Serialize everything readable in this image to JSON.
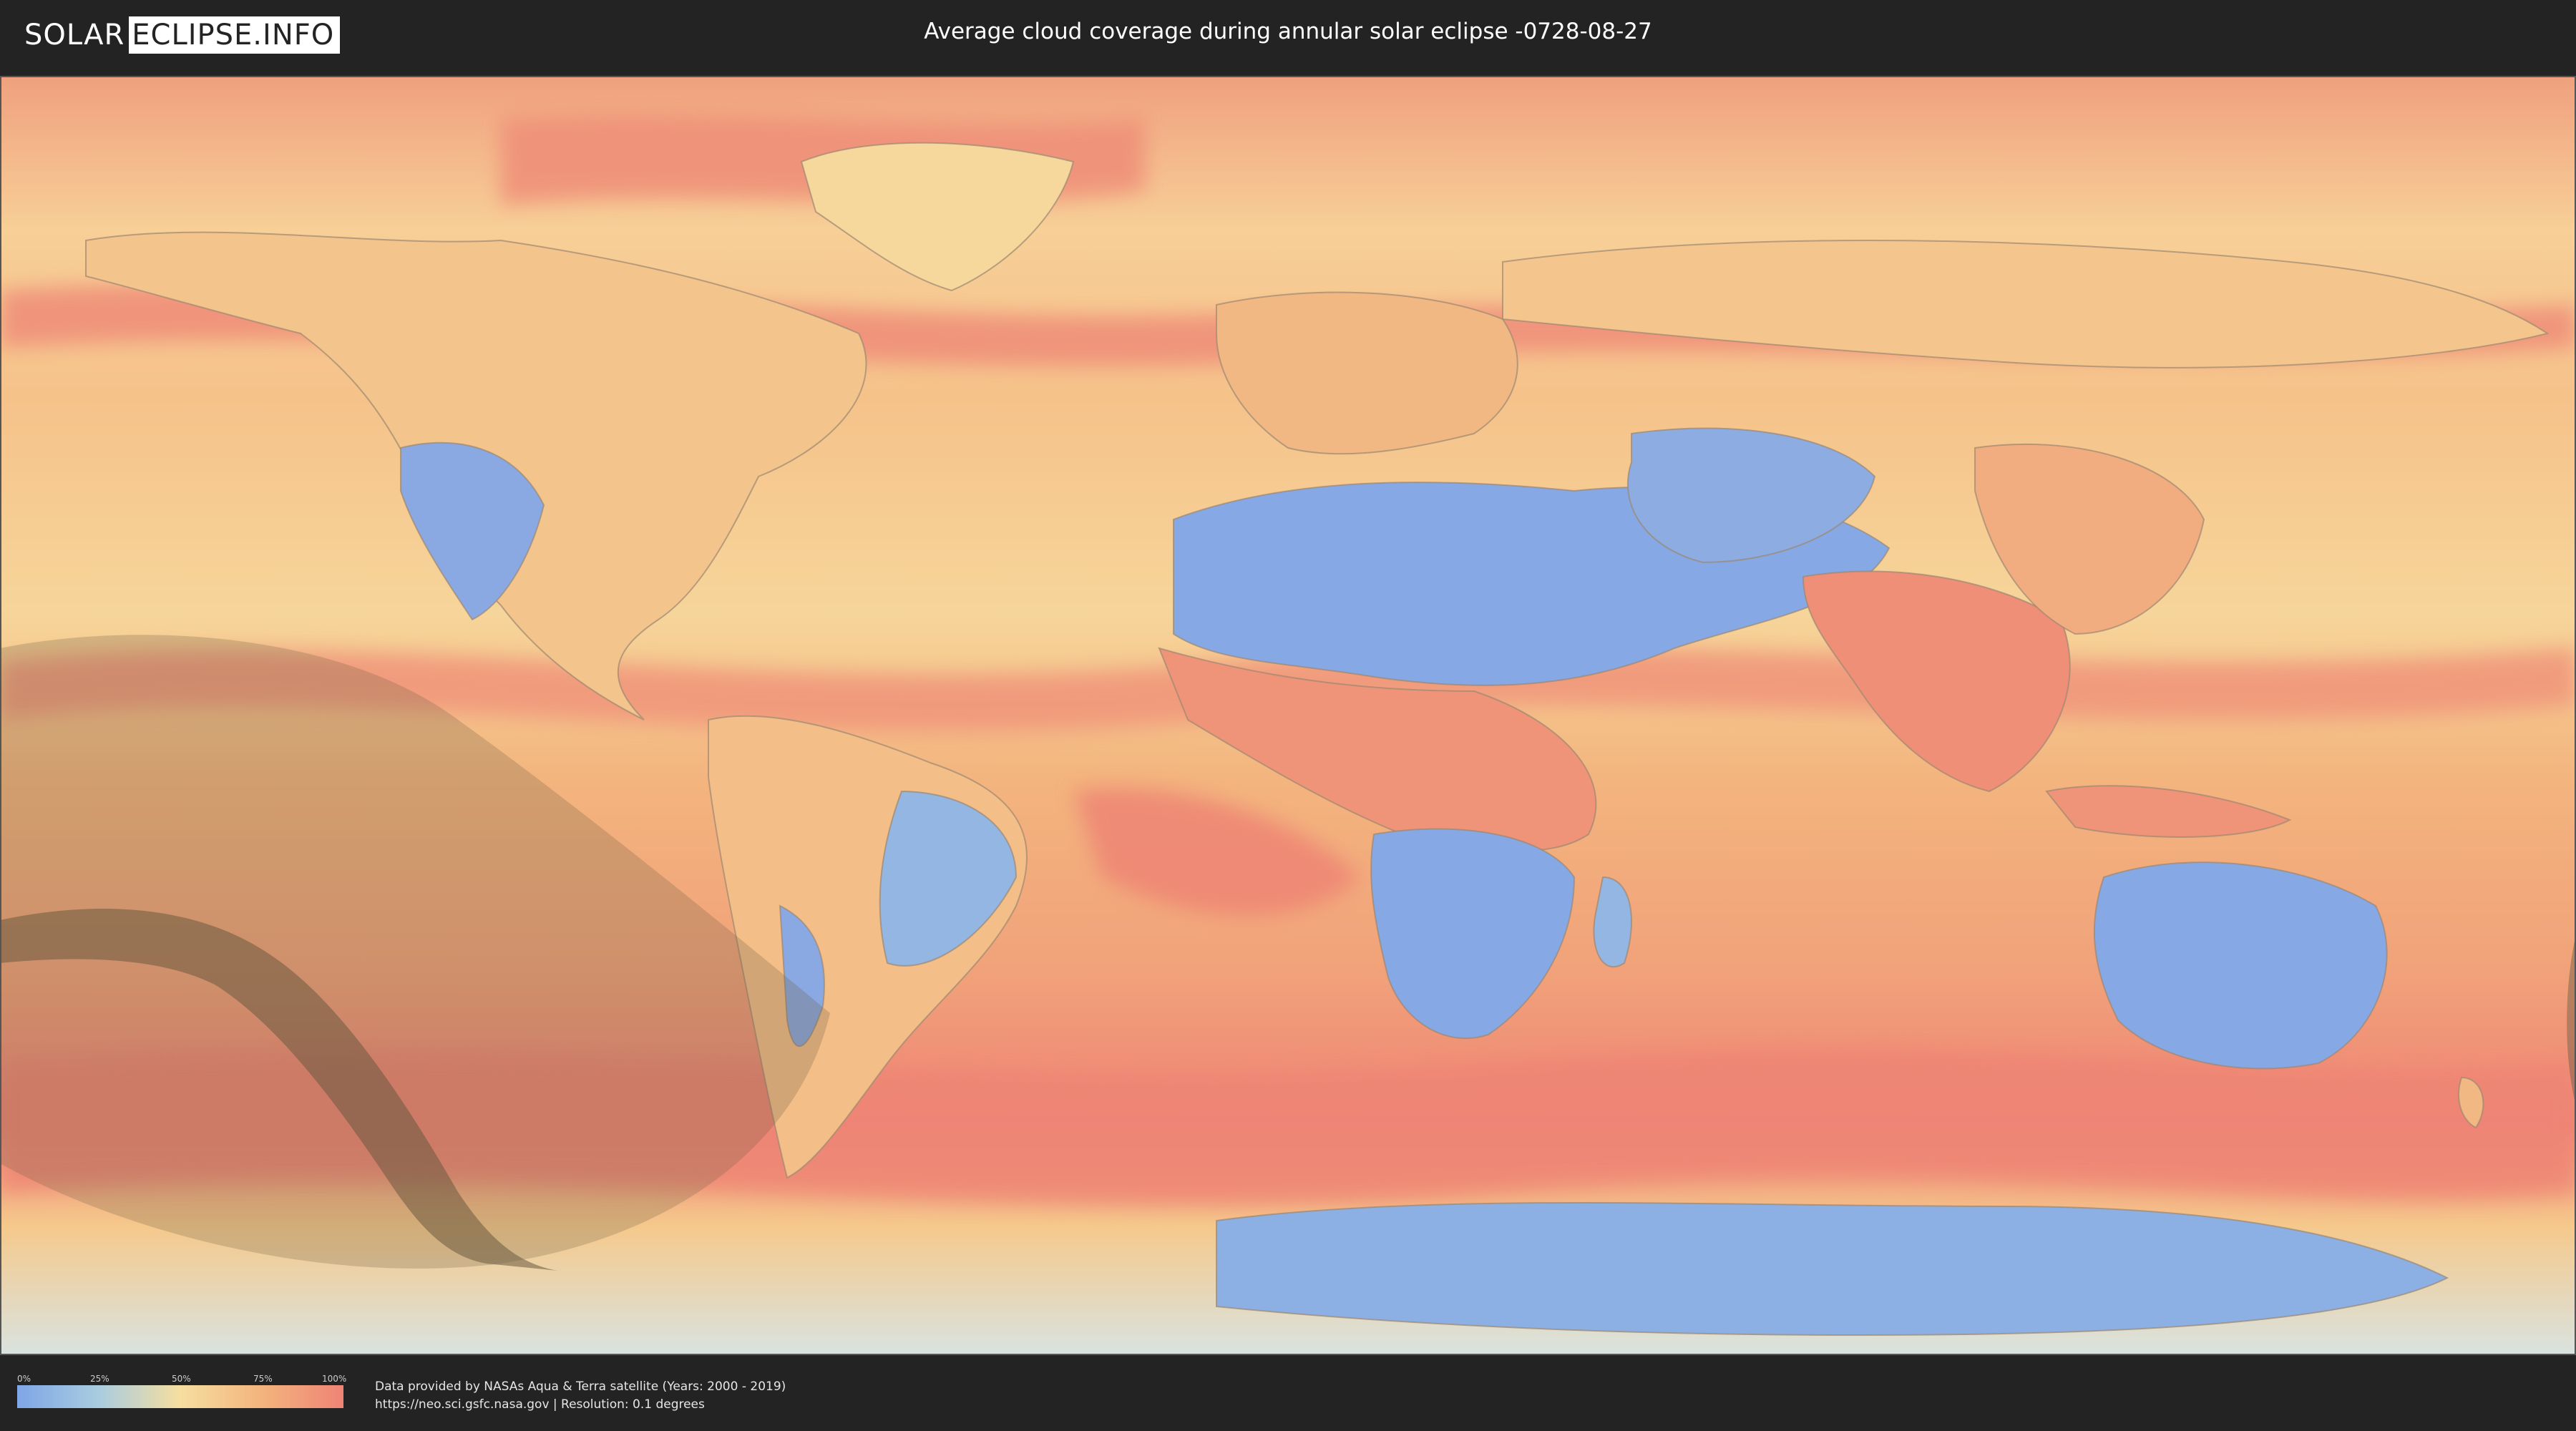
{
  "header": {
    "logo_part1": "SOLAR",
    "logo_part2": "ECLIPSE.INFO",
    "title": "Average cloud coverage during annular solar eclipse -0728-08-27"
  },
  "legend": {
    "ticks": [
      "0%",
      "25%",
      "50%",
      "75%",
      "100%"
    ],
    "gradient_colors": [
      "#7fa6e6",
      "#a9cce0",
      "#f6dea0",
      "#f3b47e",
      "#ef8375"
    ]
  },
  "credits": {
    "line1": "Data provided by NASAs Aqua & Terra satellite (Years: 2000 - 2019)",
    "line2": "https://neo.sci.gsfc.nasa.gov | Resolution: 0.1 degrees"
  },
  "colors": {
    "clear": "#7fa6e6",
    "cloudy": "#ef8375",
    "medium": "#f6dea0",
    "eclipse_overlay": "#6b5a40"
  }
}
